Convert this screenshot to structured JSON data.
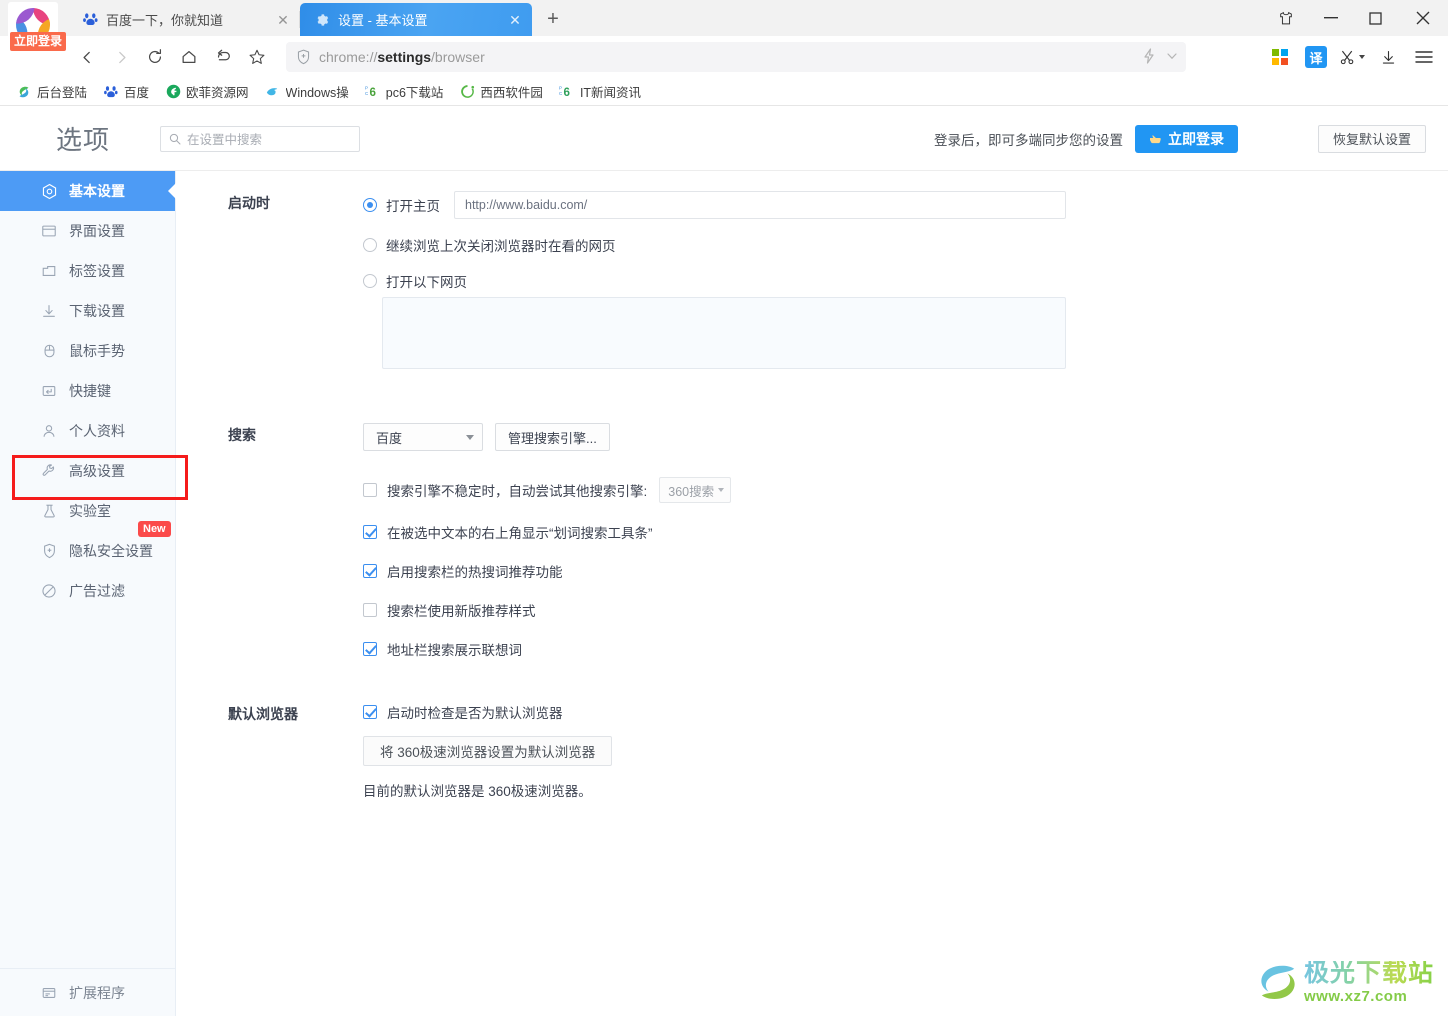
{
  "window": {
    "controls": [
      {
        "name": "skin-button",
        "label": "👕"
      },
      {
        "name": "minimize-button",
        "label": "—"
      },
      {
        "name": "maximize-button",
        "label": "□"
      },
      {
        "name": "close-button",
        "label": "✕"
      }
    ]
  },
  "brand": {
    "login_badge": "立即登录"
  },
  "tabs": [
    {
      "title": "百度一下，你就知道",
      "favicon": "baidu-paw-icon",
      "active": false,
      "close": "✕"
    },
    {
      "title": "设置 - 基本设置",
      "favicon": "gear-icon",
      "active": true,
      "close": "✕"
    }
  ],
  "new_tab_label": "+",
  "toolbar": {
    "back": "‹",
    "forward": "›",
    "reload": "↻",
    "home": "⌂",
    "restore": "↶",
    "bookmark_star": "☆",
    "url_prefix": "chrome://",
    "url_bold": "settings",
    "url_suffix": "/browser",
    "lightning": "⚡",
    "chevron": "∨",
    "translate_label": "译",
    "scissors": "✂",
    "download": "↓",
    "menu": "≡"
  },
  "bookmarks": [
    {
      "label": "后台登陆",
      "icon": "swirl-icon",
      "color": "#4bbd58"
    },
    {
      "label": "百度",
      "icon": "baidu-paw-icon",
      "color": "#2b5fd9"
    },
    {
      "label": "欧菲资源网",
      "icon": "leaf-icon",
      "color": "#1aa85c"
    },
    {
      "label": "Windows操",
      "icon": "windows-fish-icon",
      "color": "#41b6e6"
    },
    {
      "label": "pc6下载站",
      "icon": "pc6-icon",
      "color": "#4aa33c"
    },
    {
      "label": "西西软件园",
      "icon": "xixi-icon",
      "color": "#57b847"
    },
    {
      "label": "IT新闻资讯",
      "icon": "pc6-icon",
      "color": "#2fa05c"
    }
  ],
  "settings_header": {
    "title": "选项",
    "search_placeholder": "在设置中搜索",
    "sync_text": "登录后，即可多端同步您的设置",
    "login_button": "立即登录",
    "restore_button": "恢复默认设置"
  },
  "sidebar": {
    "items": [
      {
        "label": "基本设置",
        "icon": "hexagon-target-icon",
        "active": true
      },
      {
        "label": "界面设置",
        "icon": "window-icon",
        "active": false
      },
      {
        "label": "标签设置",
        "icon": "tab-icon",
        "active": false
      },
      {
        "label": "下载设置",
        "icon": "download-icon",
        "active": false
      },
      {
        "label": "鼠标手势",
        "icon": "mouse-icon",
        "active": false
      },
      {
        "label": "快捷键",
        "icon": "keyboard-key-icon",
        "active": false
      },
      {
        "label": "个人资料",
        "icon": "person-icon",
        "active": false
      },
      {
        "label": "高级设置",
        "icon": "wrench-icon",
        "active": false,
        "highlighted": true
      },
      {
        "label": "实验室",
        "icon": "flask-icon",
        "active": false
      },
      {
        "label": "隐私安全设置",
        "icon": "shield-plus-icon",
        "active": false,
        "badge": "New"
      },
      {
        "label": "广告过滤",
        "icon": "block-icon",
        "active": false
      }
    ],
    "bottom": {
      "label": "扩展程序",
      "icon": "extension-icon"
    }
  },
  "sections": {
    "startup": {
      "label": "启动时",
      "options": [
        {
          "label": "打开主页",
          "selected": true
        },
        {
          "label": "继续浏览上次关闭浏览器时在看的网页",
          "selected": false
        },
        {
          "label": "打开以下网页",
          "selected": false
        }
      ],
      "homepage_value": "http://www.baidu.com/",
      "pages_textarea_value": ""
    },
    "search": {
      "label": "搜索",
      "engine_selected": "百度",
      "manage_button": "管理搜索引擎...",
      "checkboxes": [
        {
          "label": "搜索引擎不稳定时，自动尝试其他搜索引擎:",
          "checked": false,
          "fallback_engine": "360搜索"
        },
        {
          "label": "在被选中文本的右上角显示“划词搜索工具条”",
          "checked": true
        },
        {
          "label": "启用搜索栏的热搜词推荐功能",
          "checked": true
        },
        {
          "label": "搜索栏使用新版推荐样式",
          "checked": false
        },
        {
          "label": "地址栏搜索展示联想词",
          "checked": true
        }
      ]
    },
    "default_browser": {
      "label": "默认浏览器",
      "checkbox": {
        "label": "启动时检查是否为默认浏览器",
        "checked": true
      },
      "set_default_button": "将 360极速浏览器设置为默认浏览器",
      "status_text": "目前的默认浏览器是 360极速浏览器。"
    }
  },
  "watermark": {
    "main": "极光下载站",
    "sub": "www.xz7.com"
  },
  "colors": {
    "accent_blue": "#4d9bf5",
    "tab_active": "#3f9cf0",
    "highlight_red": "#f51b1b",
    "badge_red": "#fb4a4a",
    "login_orange": "#fa6a4b"
  }
}
